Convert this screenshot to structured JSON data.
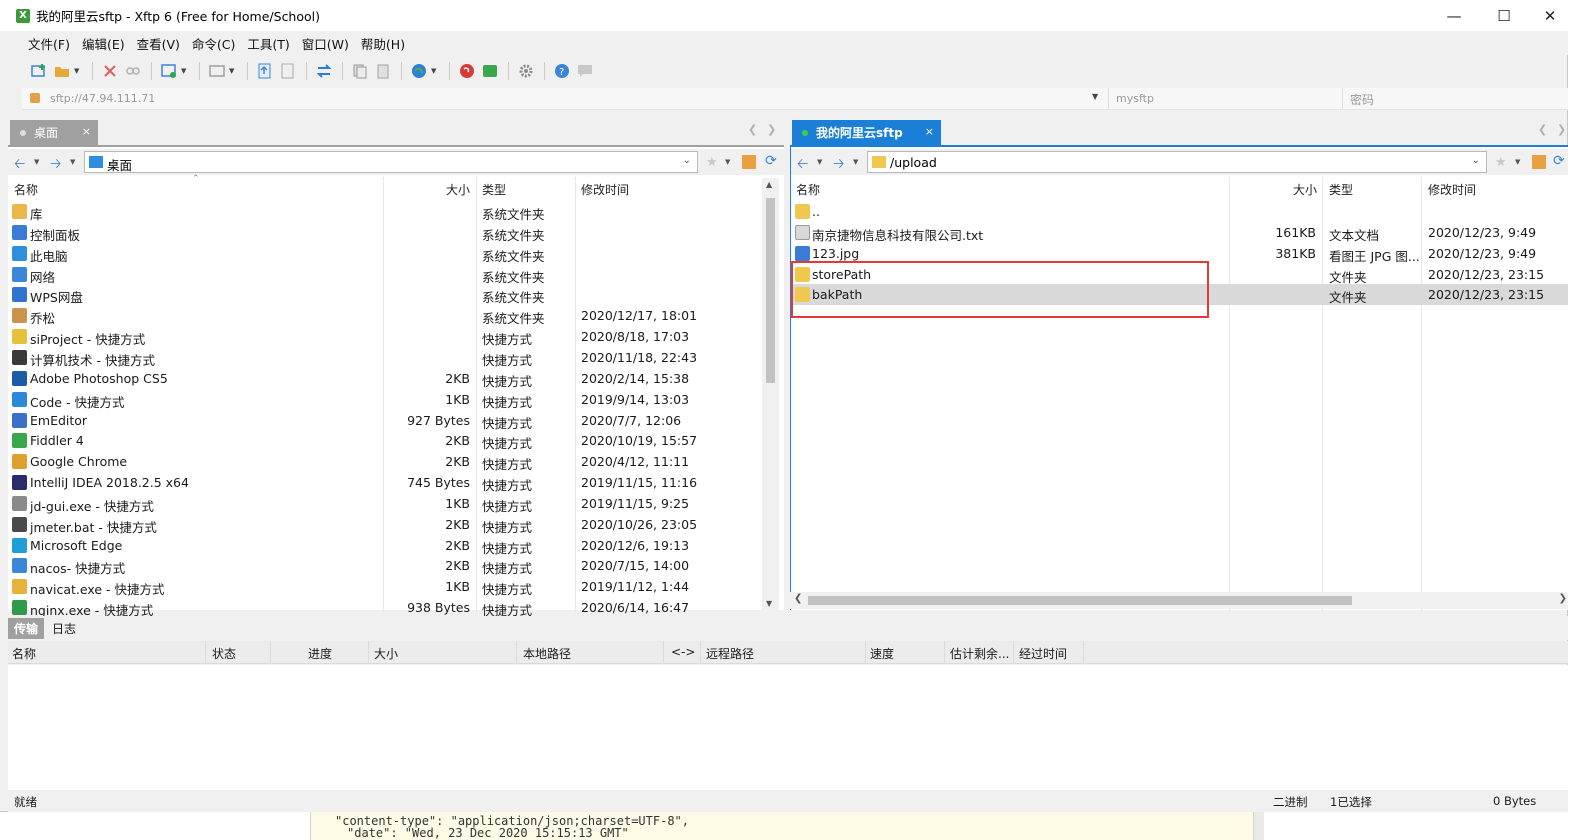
{
  "window": {
    "title": "我的阿里云sftp - Xftp 6 (Free for Home/School)",
    "app_icon_text": "X"
  },
  "menu": [
    "文件(F)",
    "编辑(E)",
    "查看(V)",
    "命令(C)",
    "工具(T)",
    "窗口(W)",
    "帮助(H)"
  ],
  "address": {
    "host": "sftp://47.94.111.71",
    "user": "mysftp",
    "password_placeholder": "密码"
  },
  "tabs": {
    "left": {
      "label": "桌面",
      "close": "×"
    },
    "right": {
      "label": "我的阿里云sftp",
      "close": "×"
    }
  },
  "left_pane": {
    "path": "桌面",
    "columns": {
      "name": "名称",
      "size": "大小",
      "type": "类型",
      "modified": "修改时间"
    },
    "rows": [
      {
        "name": "库",
        "size": "",
        "type": "系统文件夹",
        "modified": "",
        "icon": "library-icon",
        "color": "#e8b84a"
      },
      {
        "name": "控制面板",
        "size": "",
        "type": "系统文件夹",
        "modified": "",
        "icon": "control-panel-icon",
        "color": "#3a7bd5"
      },
      {
        "name": "此电脑",
        "size": "",
        "type": "系统文件夹",
        "modified": "",
        "icon": "computer-icon",
        "color": "#2f8fdc"
      },
      {
        "name": "网络",
        "size": "",
        "type": "系统文件夹",
        "modified": "",
        "icon": "network-icon",
        "color": "#3a86d8"
      },
      {
        "name": "WPS网盘",
        "size": "",
        "type": "系统文件夹",
        "modified": "",
        "icon": "cloud-icon",
        "color": "#2f74d0"
      },
      {
        "name": "乔松",
        "size": "",
        "type": "系统文件夹",
        "modified": "2020/12/17, 18:01",
        "icon": "user-icon",
        "color": "#c9944a"
      },
      {
        "name": "siProject - 快捷方式",
        "size": "",
        "type": "快捷方式",
        "modified": "2020/8/18, 17:03",
        "icon": "shortcut-icon",
        "color": "#e5c23a"
      },
      {
        "name": "计算机技术 - 快捷方式",
        "size": "",
        "type": "快捷方式",
        "modified": "2020/11/18, 22:43",
        "icon": "shortcut-icon",
        "color": "#3a3a3a"
      },
      {
        "name": "Adobe Photoshop CS5",
        "size": "2KB",
        "type": "快捷方式",
        "modified": "2020/2/14, 15:38",
        "icon": "photoshop-icon",
        "color": "#1d5aa8"
      },
      {
        "name": "Code - 快捷方式",
        "size": "1KB",
        "type": "快捷方式",
        "modified": "2019/9/14, 13:03",
        "icon": "vscode-icon",
        "color": "#2a8ad8"
      },
      {
        "name": "EmEditor",
        "size": "927 Bytes",
        "type": "快捷方式",
        "modified": "2020/7/7, 12:06",
        "icon": "editor-icon",
        "color": "#3b6fc8"
      },
      {
        "name": "Fiddler 4",
        "size": "2KB",
        "type": "快捷方式",
        "modified": "2020/10/19, 15:57",
        "icon": "fiddler-icon",
        "color": "#3aa84a"
      },
      {
        "name": "Google Chrome",
        "size": "2KB",
        "type": "快捷方式",
        "modified": "2020/4/12, 11:11",
        "icon": "chrome-icon",
        "color": "#e0a030"
      },
      {
        "name": "IntelliJ IDEA 2018.2.5 x64",
        "size": "745 Bytes",
        "type": "快捷方式",
        "modified": "2019/11/15, 11:16",
        "icon": "idea-icon",
        "color": "#2b2b6b"
      },
      {
        "name": "jd-gui.exe - 快捷方式",
        "size": "1KB",
        "type": "快捷方式",
        "modified": "2019/11/15, 9:25",
        "icon": "exe-icon",
        "color": "#8a8a8a"
      },
      {
        "name": "jmeter.bat - 快捷方式",
        "size": "2KB",
        "type": "快捷方式",
        "modified": "2020/10/26, 23:05",
        "icon": "bat-icon",
        "color": "#4a4a4a"
      },
      {
        "name": "Microsoft Edge",
        "size": "2KB",
        "type": "快捷方式",
        "modified": "2020/12/6, 19:13",
        "icon": "edge-icon",
        "color": "#1f9ed8"
      },
      {
        "name": "nacos- 快捷方式",
        "size": "2KB",
        "type": "快捷方式",
        "modified": "2020/7/15, 14:00",
        "icon": "shortcut-icon",
        "color": "#3a86d8"
      },
      {
        "name": "navicat.exe - 快捷方式",
        "size": "1KB",
        "type": "快捷方式",
        "modified": "2019/11/12, 1:44",
        "icon": "navicat-icon",
        "color": "#e5b23a"
      },
      {
        "name": "nginx.exe - 快捷方式",
        "size": "938 Bytes",
        "type": "快捷方式",
        "modified": "2020/6/14, 16:47",
        "icon": "nginx-icon",
        "color": "#2e9a4a"
      }
    ]
  },
  "right_pane": {
    "path": "/upload",
    "columns": {
      "name": "名称",
      "size": "大小",
      "type": "类型",
      "modified": "修改时间"
    },
    "rows": [
      {
        "name": "..",
        "size": "",
        "type": "",
        "modified": "",
        "icon": "folder-icon",
        "color": "#f0c850",
        "selected": false
      },
      {
        "name": "南京捷物信息科技有限公司.txt",
        "size": "161KB",
        "type": "文本文档",
        "modified": "2020/12/23, 9:49",
        "icon": "text-file-icon",
        "color": "#d8d8d8",
        "selected": false
      },
      {
        "name": "123.jpg",
        "size": "381KB",
        "type": "看图王 JPG 图...",
        "modified": "2020/12/23, 9:49",
        "icon": "image-file-icon",
        "color": "#3a7bd5",
        "selected": false
      },
      {
        "name": "storePath",
        "size": "",
        "type": "文件夹",
        "modified": "2020/12/23, 23:15",
        "icon": "folder-icon",
        "color": "#f0c850",
        "selected": false
      },
      {
        "name": "bakPath",
        "size": "",
        "type": "文件夹",
        "modified": "2020/12/23, 23:15",
        "icon": "folder-icon",
        "color": "#f0c850",
        "selected": true
      }
    ]
  },
  "transfer": {
    "tabs": [
      "传输",
      "日志"
    ],
    "columns": [
      "名称",
      "状态",
      "进度",
      "大小",
      "本地路径",
      "<->",
      "远程路径",
      "速度",
      "估计剩余...",
      "经过时间"
    ]
  },
  "status": {
    "left": "就绪",
    "mode": "二进制",
    "selection": "1已选择",
    "size": "0 Bytes"
  },
  "background_text": {
    "line1": "\"content-type\": \"application/json;charset=UTF-8\",",
    "line2": "\"date\": \"Wed, 23 Dec 2020 15:15:13 GMT\""
  },
  "colors": {
    "accent": "#1b7fd8",
    "highlight_box": "#e53935",
    "selected_row": "#d9d9d9",
    "folder": "#f0c850"
  }
}
